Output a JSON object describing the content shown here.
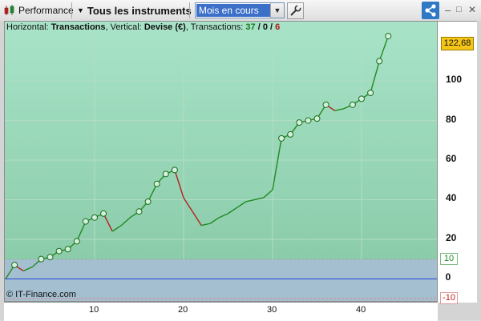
{
  "toolbar": {
    "performance_label": "Performance",
    "instruments_label": "Tous les instruments",
    "period_value": "Mois en cours"
  },
  "chart_info": {
    "horizontal_label": "Horizontal:",
    "horizontal_value": "Transactions",
    "vertical_label": "Vertical:",
    "vertical_value": "Devise (€)",
    "transactions_label": "Transactions:",
    "wins": "37",
    "neutral": "0",
    "losses": "6"
  },
  "copyright": "© IT-Finance.com",
  "last_value": "122,68",
  "reference_levels": {
    "upper": "10",
    "zero": "0",
    "lower": "-10"
  },
  "colors": {
    "gain": "#1f8a1f",
    "loss": "#b52020",
    "zero_line": "#2244dd",
    "badge": "#f5c518"
  },
  "chart_data": {
    "type": "line",
    "xlabel": "Transactions",
    "ylabel": "Devise (€)",
    "xlim": [
      0,
      48
    ],
    "ylim": [
      -12,
      130
    ],
    "x_ticks": [
      10,
      20,
      30,
      40
    ],
    "y_ticks": [
      0,
      20,
      40,
      60,
      80,
      100
    ],
    "x": [
      0,
      1,
      2,
      3,
      4,
      5,
      6,
      7,
      8,
      9,
      10,
      11,
      12,
      13,
      14,
      15,
      16,
      17,
      18,
      19,
      20,
      21,
      22,
      23,
      24,
      25,
      26,
      27,
      28,
      29,
      30,
      31,
      32,
      33,
      34,
      35,
      36,
      37,
      38,
      39,
      40,
      41,
      42,
      43
    ],
    "values": [
      0,
      7,
      4,
      6,
      10,
      11,
      14,
      15,
      19,
      29,
      31,
      33,
      24,
      27,
      31,
      34,
      39,
      48,
      53,
      55,
      41,
      34,
      27,
      28,
      31,
      33,
      36,
      39,
      40,
      41,
      45,
      71,
      73,
      79,
      80,
      81,
      88,
      85,
      86,
      88,
      91,
      94,
      110,
      122.68
    ],
    "markers": [
      1,
      4,
      5,
      6,
      7,
      8,
      9,
      10,
      11,
      15,
      16,
      17,
      18,
      19,
      31,
      32,
      33,
      34,
      35,
      36,
      39,
      40,
      41,
      42,
      43
    ]
  }
}
